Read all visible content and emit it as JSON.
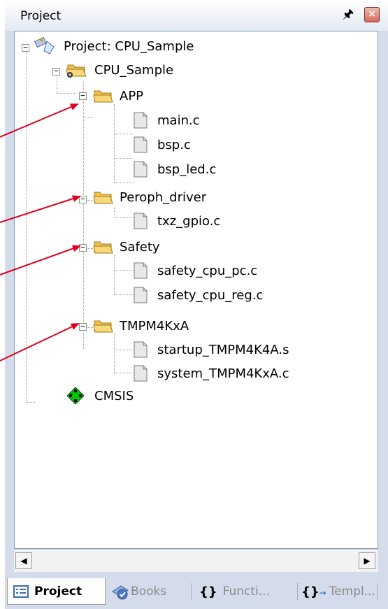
{
  "panel": {
    "title": "Project"
  },
  "tree": {
    "root": {
      "label": "Project: CPU_Sample"
    },
    "target": {
      "label": "CPU_Sample"
    },
    "groups": [
      {
        "label": "APP",
        "files": [
          "main.c",
          "bsp.c",
          "bsp_led.c"
        ]
      },
      {
        "label": "Peroph_driver",
        "files": [
          "txz_gpio.c"
        ]
      },
      {
        "label": "Safety",
        "files": [
          "safety_cpu_pc.c",
          "safety_cpu_reg.c"
        ]
      },
      {
        "label": "TMPM4KxA",
        "files": [
          "startup_TMPM4K4A.s",
          "system_TMPM4KxA.c"
        ]
      }
    ],
    "cmsis": {
      "label": "CMSIS"
    }
  },
  "tabs": [
    {
      "label": "Project",
      "icon": "project-tab-icon",
      "active": true
    },
    {
      "label": "Books",
      "icon": "books-icon",
      "active": false
    },
    {
      "label": "Functi...",
      "icon": "braces-icon",
      "active": false
    },
    {
      "label": "Templ...",
      "icon": "template-icon",
      "active": false
    }
  ],
  "colors": {
    "panel_bg": "#d4dbea",
    "folder": "#f0c24b",
    "annotation_arrow": "#e0001b",
    "cmsis_icon": "#00c000"
  }
}
